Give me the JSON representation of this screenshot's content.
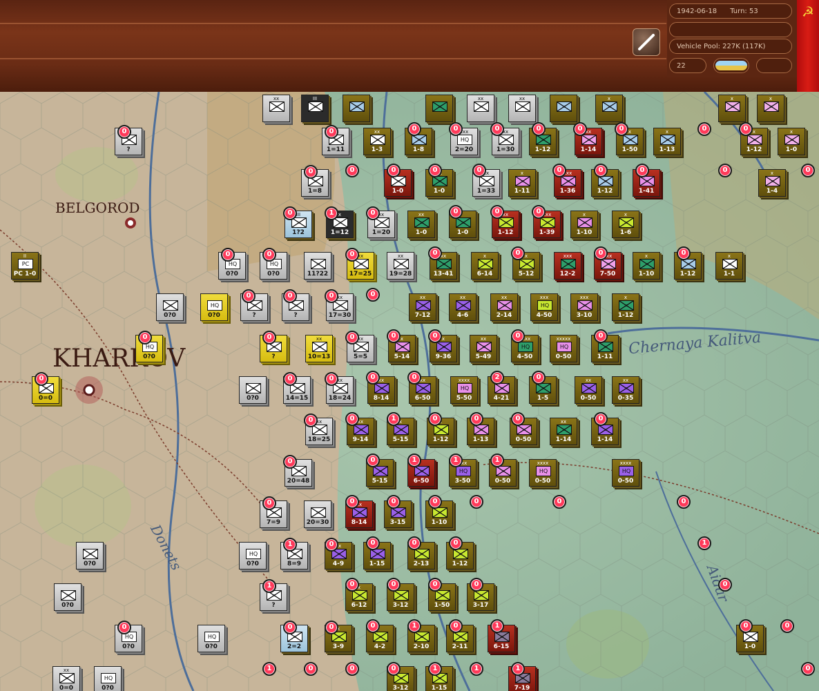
{
  "header": {
    "date": "1942-06-18",
    "turn_label": "Turn: 53",
    "vehicle_pool": "Vehicle Pool: 227K (117K)",
    "small_value": "22",
    "empty_field": "",
    "weather_icon": "clear-weather-icon",
    "pencil_icon": "pencil-icon",
    "faction_icon": "hammer-sickle-icon"
  },
  "colors": {
    "soviet_counter": "#7a6a14",
    "axis_counter": "#c8c8c8",
    "hungarian_counter": "#e8d020",
    "red_counter": "#a8281a",
    "badge": "#ff3a5a",
    "topbar": "#6a2c15",
    "faction_panel": "#c8140e"
  },
  "map": {
    "cities": [
      "BELGOROD",
      "KHARKOV"
    ],
    "rivers": [
      "Chernaya Kalitva",
      "Donets",
      "Aidar"
    ]
  },
  "units": [
    {
      "s": "",
      "e": "xx",
      "c": "ger",
      "sym": "#fff"
    },
    {
      "s": "",
      "e": "III",
      "c": "dark",
      "sym": "#fff"
    },
    {
      "s": "",
      "e": "",
      "c": "sov",
      "sym": "#a8cce8"
    },
    {
      "s": "",
      "e": "",
      "c": "sov",
      "sym": "#2e9e6a"
    },
    {
      "s": "",
      "e": "xx",
      "c": "ger",
      "sym": "#fff"
    },
    {
      "s": "",
      "e": "xx",
      "c": "ger",
      "sym": "#fff"
    },
    {
      "s": "",
      "e": "",
      "c": "sov",
      "sym": "#a8cce8"
    },
    {
      "s": "",
      "e": "x",
      "c": "sov",
      "sym": "#a8cce8"
    },
    {
      "s": "",
      "e": "x",
      "c": "sov",
      "sym": "#f0b0e8"
    },
    {
      "s": "",
      "e": "x",
      "c": "sov",
      "sym": "#f0b0e8"
    },
    {
      "s": "?",
      "e": "",
      "c": "ger",
      "sym": "#fff"
    },
    {
      "s": "1=11",
      "e": "xx",
      "c": "ger",
      "sym": "#fff"
    },
    {
      "s": "1-3",
      "e": "xx",
      "c": "sov",
      "sym": "#fff"
    },
    {
      "s": "1-8",
      "e": "x",
      "c": "sov",
      "sym": "#a8cce8"
    },
    {
      "s": "2=20",
      "e": "xxx",
      "c": "ger",
      "sym": "#fff",
      "txt": "HQ"
    },
    {
      "s": "1=30",
      "e": "xx",
      "c": "ger",
      "sym": "#fff"
    },
    {
      "s": "1-12",
      "e": "xx",
      "c": "sov",
      "sym": "#2e9e6a"
    },
    {
      "s": "1-14",
      "e": "xx",
      "c": "red",
      "sym": "#f0a0ea"
    },
    {
      "s": "1-50",
      "e": "x",
      "c": "sov",
      "sym": "#a8cce8"
    },
    {
      "s": "1-13",
      "e": "x",
      "c": "sov",
      "sym": "#a8cce8"
    },
    {
      "s": "1-12",
      "e": "x",
      "c": "sov",
      "sym": "#f0b0e8"
    },
    {
      "s": "1-0",
      "e": "x",
      "c": "sov",
      "sym": "#f0b0e8"
    },
    {
      "s": "1=8",
      "e": "",
      "c": "ger",
      "sym": "#fff"
    },
    {
      "s": "1-0",
      "e": "",
      "c": "red",
      "sym": "#fff"
    },
    {
      "s": "1-0",
      "e": "xx",
      "c": "sov",
      "sym": "#2e9e6a"
    },
    {
      "s": "1=33",
      "e": "xx",
      "c": "ger",
      "sym": "#fff"
    },
    {
      "s": "1-11",
      "e": "x",
      "c": "sov",
      "sym": "#e890e8"
    },
    {
      "s": "1-36",
      "e": "xxx",
      "c": "red",
      "sym": "#e890e8"
    },
    {
      "s": "1-12",
      "e": "",
      "c": "sov",
      "sym": "#a8cce8"
    },
    {
      "s": "1-41",
      "e": "x",
      "c": "red",
      "sym": "#e890e8"
    },
    {
      "s": "1-4",
      "e": "x",
      "c": "sov",
      "sym": "#f0b0e8"
    },
    {
      "s": "PC 1-0",
      "e": "II",
      "c": "sov",
      "sym": "#fff",
      "txt": "PC"
    },
    {
      "s": "1?2",
      "e": "III",
      "c": "lblue",
      "sym": "#fff"
    },
    {
      "s": "1=12",
      "e": "x",
      "c": "dark",
      "sym": "#fff"
    },
    {
      "s": "1=20",
      "e": "xx",
      "c": "ger",
      "sym": "#fff"
    },
    {
      "s": "1-0",
      "e": "xx",
      "c": "sov",
      "sym": "#2e9e6a"
    },
    {
      "s": "1-0",
      "e": "",
      "c": "sov",
      "sym": "#2e9e6a"
    },
    {
      "s": "1-12",
      "e": "xx",
      "c": "red",
      "sym": "#c8e830"
    },
    {
      "s": "1-39",
      "e": "xxx",
      "c": "red",
      "sym": "#c8e830"
    },
    {
      "s": "1-10",
      "e": "x",
      "c": "sov",
      "sym": "#e890e8"
    },
    {
      "s": "1-6",
      "e": "x",
      "c": "sov",
      "sym": "#c8e830"
    },
    {
      "s": "0?0",
      "e": "",
      "c": "ger",
      "sym": "#fff",
      "txt": "HQ"
    },
    {
      "s": "0?0",
      "e": "",
      "c": "ger",
      "sym": "#fff",
      "txt": "HQ"
    },
    {
      "s": "11?22",
      "e": "",
      "c": "ger",
      "sym": "#fff"
    },
    {
      "s": "17=25",
      "e": "xx",
      "c": "yel",
      "sym": "#fff"
    },
    {
      "s": "19=28",
      "e": "xx",
      "c": "ger",
      "sym": "#fff"
    },
    {
      "s": "13-41",
      "e": "xx",
      "c": "sov",
      "sym": "#2e9e6a"
    },
    {
      "s": "6-14",
      "e": "x",
      "c": "sov",
      "sym": "#c8e830"
    },
    {
      "s": "5-12",
      "e": "x",
      "c": "sov",
      "sym": "#c8e830"
    },
    {
      "s": "12-2",
      "e": "xxx",
      "c": "red",
      "sym": "#2e9e6a"
    },
    {
      "s": "7-50",
      "e": "xxx",
      "c": "red",
      "sym": "#f0a0ea"
    },
    {
      "s": "1-10",
      "e": "x",
      "c": "sov",
      "sym": "#2e9e6a"
    },
    {
      "s": "1-12",
      "e": "x",
      "c": "sov",
      "sym": "#a8cce8"
    },
    {
      "s": "1-1",
      "e": "x",
      "c": "sov",
      "sym": "#fff"
    },
    {
      "s": "0?0",
      "e": "",
      "c": "ger",
      "sym": "#fff"
    },
    {
      "s": "0?0",
      "e": "",
      "c": "yel",
      "sym": "#fff",
      "txt": "HQ"
    },
    {
      "s": "?",
      "e": "",
      "c": "ger",
      "sym": "#fff"
    },
    {
      "s": "?",
      "e": "",
      "c": "ger",
      "sym": "#fff"
    },
    {
      "s": "17=30",
      "e": "xx",
      "c": "ger",
      "sym": "#fff"
    },
    {
      "s": "7-12",
      "e": "xx",
      "c": "sov",
      "sym": "#9a60e8"
    },
    {
      "s": "4-6",
      "e": "xx",
      "c": "sov",
      "sym": "#9a60e8"
    },
    {
      "s": "2-14",
      "e": "xx",
      "c": "sov",
      "sym": "#e890e8"
    },
    {
      "s": "4-50",
      "e": "xxx",
      "c": "sov",
      "sym": "#c8e830",
      "txt": "HQ"
    },
    {
      "s": "3-10",
      "e": "xxx",
      "c": "sov",
      "sym": "#e890e8"
    },
    {
      "s": "1-12",
      "e": "x",
      "c": "sov",
      "sym": "#2e9e6a"
    },
    {
      "s": "0?0",
      "e": "",
      "c": "yel",
      "sym": "#fff",
      "txt": "HQ"
    },
    {
      "s": "?",
      "e": "",
      "c": "yel",
      "sym": "#fff"
    },
    {
      "s": "10=13",
      "e": "xx",
      "c": "yel",
      "sym": "#fff"
    },
    {
      "s": "5=5",
      "e": "xx",
      "c": "ger",
      "sym": "#fff"
    },
    {
      "s": "5-14",
      "e": "x",
      "c": "sov",
      "sym": "#e890e8"
    },
    {
      "s": "9-36",
      "e": "x",
      "c": "sov",
      "sym": "#9a60e8"
    },
    {
      "s": "5-49",
      "e": "xx",
      "c": "sov",
      "sym": "#e890e8"
    },
    {
      "s": "4-50",
      "e": "xxxx",
      "c": "sov",
      "sym": "#2e9e6a",
      "txt": "HQ"
    },
    {
      "s": "0-50",
      "e": "xxxxx",
      "c": "sov",
      "sym": "#e890e8",
      "txt": "HQ"
    },
    {
      "s": "1-11",
      "e": "",
      "c": "sov",
      "sym": "#2e9e6a"
    },
    {
      "s": "0=0",
      "e": "",
      "c": "yel",
      "sym": "#fff"
    },
    {
      "s": "0?0",
      "e": "",
      "c": "ger",
      "sym": "#fff"
    },
    {
      "s": "14=15",
      "e": "",
      "c": "ger",
      "sym": "#fff"
    },
    {
      "s": "18=24",
      "e": "xx",
      "c": "ger",
      "sym": "#fff"
    },
    {
      "s": "8-14",
      "e": "xx",
      "c": "sov",
      "sym": "#9a60e8"
    },
    {
      "s": "6-50",
      "e": "xx",
      "c": "sov",
      "sym": "#9a60e8"
    },
    {
      "s": "5-50",
      "e": "xxxx",
      "c": "sov",
      "sym": "#e890e8",
      "txt": "HQ"
    },
    {
      "s": "4-21",
      "e": "x",
      "c": "sov",
      "sym": "#e890e8"
    },
    {
      "s": "1-5",
      "e": "x",
      "c": "sov",
      "sym": "#2e9e6a"
    },
    {
      "s": "0-50",
      "e": "xx",
      "c": "sov",
      "sym": "#9a60e8"
    },
    {
      "s": "0-35",
      "e": "xx",
      "c": "sov",
      "sym": "#9a60e8"
    },
    {
      "s": "18=25",
      "e": "xx",
      "c": "ger",
      "sym": "#fff"
    },
    {
      "s": "9-14",
      "e": "xx",
      "c": "sov",
      "sym": "#9a60e8"
    },
    {
      "s": "5-15",
      "e": "x",
      "c": "sov",
      "sym": "#9a60e8"
    },
    {
      "s": "1-12",
      "e": "x",
      "c": "sov",
      "sym": "#c8e830"
    },
    {
      "s": "1-13",
      "e": "x",
      "c": "sov",
      "sym": "#e890e8"
    },
    {
      "s": "0-50",
      "e": "",
      "c": "sov",
      "sym": "#e890e8"
    },
    {
      "s": "1-14",
      "e": "xx",
      "c": "sov",
      "sym": "#2e9e6a"
    },
    {
      "s": "1-14",
      "e": "",
      "c": "sov",
      "sym": "#9a60e8"
    },
    {
      "s": "20=48",
      "e": "",
      "c": "ger",
      "sym": "#fff"
    },
    {
      "s": "5-15",
      "e": "",
      "c": "sov",
      "sym": "#9a60e8"
    },
    {
      "s": "6-50",
      "e": "",
      "c": "red",
      "sym": "#9a60e8"
    },
    {
      "s": "3-50",
      "e": "xxx",
      "c": "sov",
      "sym": "#9a60e8",
      "txt": "HQ"
    },
    {
      "s": "0-50",
      "e": "",
      "c": "sov",
      "sym": "#e890e8"
    },
    {
      "s": "0-50",
      "e": "xxxx",
      "c": "sov",
      "sym": "#e890e8",
      "txt": "HQ"
    },
    {
      "s": "0-50",
      "e": "xxxx",
      "c": "sov",
      "sym": "#9a60e8",
      "txt": "HQ"
    },
    {
      "s": "7=9",
      "e": "",
      "c": "ger",
      "sym": "#fff"
    },
    {
      "s": "20=30",
      "e": "",
      "c": "ger",
      "sym": "#fff"
    },
    {
      "s": "8-14",
      "e": "xx",
      "c": "red",
      "sym": "#9a60e8"
    },
    {
      "s": "3-15",
      "e": "",
      "c": "sov",
      "sym": "#9a60e8"
    },
    {
      "s": "1-10",
      "e": "",
      "c": "sov",
      "sym": "#c8e830"
    },
    {
      "s": "0?0",
      "e": "",
      "c": "ger",
      "sym": "#fff"
    },
    {
      "s": "0?0",
      "e": "",
      "c": "ger",
      "sym": "#fff",
      "txt": "HQ"
    },
    {
      "s": "8=9",
      "e": "",
      "c": "ger",
      "sym": "#fff"
    },
    {
      "s": "4-9",
      "e": "xx",
      "c": "sov",
      "sym": "#9a60e8"
    },
    {
      "s": "1-15",
      "e": "",
      "c": "sov",
      "sym": "#9a60e8"
    },
    {
      "s": "2-13",
      "e": "",
      "c": "sov",
      "sym": "#c8e830"
    },
    {
      "s": "1-12",
      "e": "",
      "c": "sov",
      "sym": "#c8e830"
    },
    {
      "s": "0?0",
      "e": "",
      "c": "ger",
      "sym": "#fff"
    },
    {
      "s": "?",
      "e": "",
      "c": "ger",
      "sym": "#fff"
    },
    {
      "s": "6-12",
      "e": "x",
      "c": "sov",
      "sym": "#c8e830"
    },
    {
      "s": "3-12",
      "e": "",
      "c": "sov",
      "sym": "#c8e830"
    },
    {
      "s": "1-50",
      "e": "",
      "c": "sov",
      "sym": "#c8e830"
    },
    {
      "s": "3-17",
      "e": "x",
      "c": "sov",
      "sym": "#c8e830"
    },
    {
      "s": "0?0",
      "e": "",
      "c": "ger",
      "sym": "#fff",
      "txt": "HQ"
    },
    {
      "s": "0?0",
      "e": "",
      "c": "ger",
      "sym": "#fff",
      "txt": "HQ"
    },
    {
      "s": "2=2",
      "e": "",
      "c": "lblue",
      "sym": "#fff"
    },
    {
      "s": "3-9",
      "e": "x",
      "c": "sov",
      "sym": "#c8e830"
    },
    {
      "s": "4-2",
      "e": "",
      "c": "sov",
      "sym": "#c8e830"
    },
    {
      "s": "2-10",
      "e": "",
      "c": "sov",
      "sym": "#c8e830"
    },
    {
      "s": "2-11",
      "e": "",
      "c": "sov",
      "sym": "#c8e830"
    },
    {
      "s": "6-15",
      "e": "",
      "c": "red",
      "sym": "#8a7a9a"
    },
    {
      "s": "1-0",
      "e": "",
      "c": "sov",
      "sym": "#fff"
    },
    {
      "s": "0=0",
      "e": "xx",
      "c": "ger",
      "sym": "#fff"
    },
    {
      "s": "0?0",
      "e": "",
      "c": "ger",
      "sym": "#fff",
      "txt": "HQ"
    },
    {
      "s": "7-19",
      "e": "x",
      "c": "red",
      "sym": "#8a7a9a"
    },
    {
      "s": "3-12",
      "e": "",
      "c": "sov",
      "sym": "#c8e830"
    },
    {
      "s": "1-15",
      "e": "",
      "c": "sov",
      "sym": "#c8e830"
    }
  ],
  "badges": [
    "0",
    "0",
    "0",
    "0",
    "0",
    "0",
    "0",
    "0",
    "0",
    "0",
    "0",
    "0",
    "0",
    "0",
    "0",
    "0",
    "0",
    "0",
    "0",
    "0",
    "0",
    "1",
    "0",
    "0",
    "0",
    "0",
    "0",
    "0",
    "0",
    "0",
    "0",
    "0",
    "0",
    "0",
    "0",
    "0",
    "0",
    "0",
    "0",
    "0",
    "0",
    "0",
    "0",
    "0",
    "0",
    "0",
    "0",
    "0",
    "0",
    "2",
    "0",
    "0",
    "0",
    "1",
    "0",
    "0",
    "0",
    "0",
    "0",
    "1",
    "1",
    "1",
    "0",
    "0",
    "0",
    "0",
    "0",
    "0",
    "0",
    "0",
    "1",
    "0",
    "0",
    "0",
    "0",
    "1",
    "1",
    "0",
    "0",
    "0",
    "0",
    "0",
    "0",
    "0",
    "0",
    "0",
    "1",
    "0",
    "1",
    "0",
    "0",
    "1",
    "0",
    "0",
    "0",
    "1",
    "1",
    "1",
    "0",
    "0",
    "0",
    "0",
    "1",
    "0",
    "2",
    "0",
    "1",
    "1",
    "1",
    "1",
    "1",
    "2",
    "2",
    "2",
    "0",
    "0",
    "0",
    "1",
    "0",
    "2",
    "1",
    "2"
  ]
}
